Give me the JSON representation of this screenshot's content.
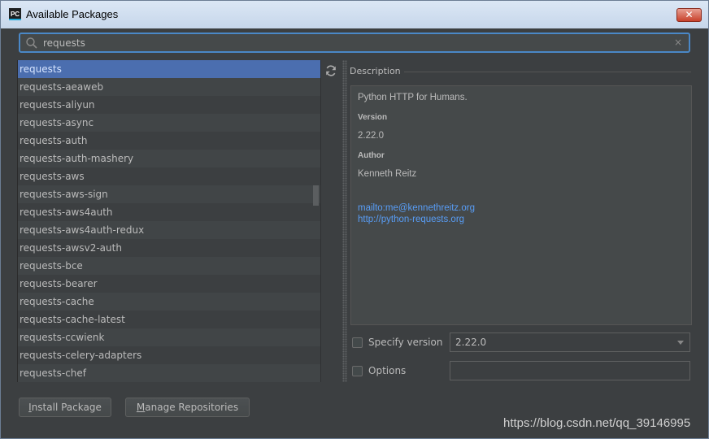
{
  "window": {
    "title": "Available Packages",
    "app_icon_text": "PC",
    "close_glyph": "✕"
  },
  "search": {
    "value": "requests",
    "clear_glyph": "×"
  },
  "packages": [
    {
      "name": "requests",
      "selected": true
    },
    {
      "name": "requests-aeaweb"
    },
    {
      "name": "requests-aliyun"
    },
    {
      "name": "requests-async"
    },
    {
      "name": "requests-auth"
    },
    {
      "name": "requests-auth-mashery"
    },
    {
      "name": "requests-aws"
    },
    {
      "name": "requests-aws-sign"
    },
    {
      "name": "requests-aws4auth"
    },
    {
      "name": "requests-aws4auth-redux"
    },
    {
      "name": "requests-awsv2-auth"
    },
    {
      "name": "requests-bce"
    },
    {
      "name": "requests-bearer"
    },
    {
      "name": "requests-cache"
    },
    {
      "name": "requests-cache-latest"
    },
    {
      "name": "requests-ccwienk"
    },
    {
      "name": "requests-celery-adapters"
    },
    {
      "name": "requests-chef"
    }
  ],
  "description": {
    "label": "Description",
    "summary": "Python HTTP for Humans.",
    "version_heading": "Version",
    "version": "2.22.0",
    "author_heading": "Author",
    "author": "Kenneth Reitz",
    "email_link": "mailto:me@kennethreitz.org",
    "homepage_link": "http://python-requests.org"
  },
  "options": {
    "specify_version_label": "Specify version",
    "specify_version_checked": false,
    "version_value": "2.22.0",
    "options_label": "Options",
    "options_checked": false,
    "options_value": ""
  },
  "buttons": {
    "install_first": "I",
    "install_rest": "nstall Package",
    "manage_first": "M",
    "manage_rest": "anage Repositories"
  },
  "watermark": "https://blog.csdn.net/qq_39146995",
  "colors": {
    "background": "#3c3f41",
    "selection": "#4b6eaf",
    "link": "#589df6",
    "focus_border": "#4a88c7"
  }
}
